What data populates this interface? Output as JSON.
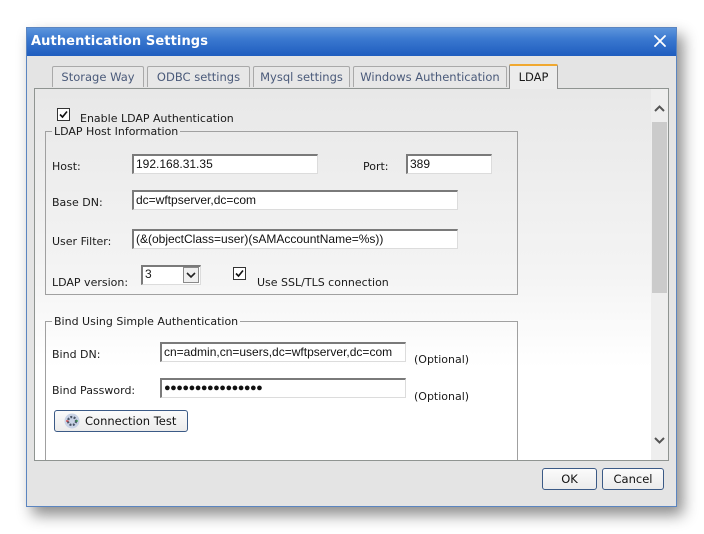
{
  "window": {
    "title": "Authentication Settings",
    "close_icon": "close-icon"
  },
  "tabs": [
    {
      "label": "Storage Way",
      "active": false
    },
    {
      "label": "ODBC settings",
      "active": false
    },
    {
      "label": "Mysql settings",
      "active": false
    },
    {
      "label": "Windows Authentication",
      "active": false
    },
    {
      "label": "LDAP",
      "active": true
    }
  ],
  "ldap": {
    "enable": {
      "label": "Enable LDAP Authentication",
      "checked": true
    },
    "host_group": {
      "legend": "LDAP Host Information",
      "host_label": "Host:",
      "host_value": "192.168.31.35",
      "port_label": "Port:",
      "port_value": "389",
      "base_dn_label": "Base DN:",
      "base_dn_value": "dc=wftpserver,dc=com",
      "user_filter_label": "User Filter:",
      "user_filter_value": "(&(objectClass=user)(sAMAccountName=%s))",
      "version_label": "LDAP version:",
      "version_value": "3",
      "ssl": {
        "label": "Use SSL/TLS connection",
        "checked": true
      }
    },
    "bind_group": {
      "legend": "Bind Using Simple Authentication",
      "bind_dn_label": "Bind DN:",
      "bind_dn_value": "cn=admin,cn=users,dc=wftpserver,dc=com",
      "bind_dn_hint": "(Optional)",
      "bind_password_label": "Bind Password:",
      "bind_password_value": "●●●●●●●●●●●●●●●●",
      "bind_password_hint": "(Optional)",
      "connection_test_label": "Connection Test",
      "connection_test_icon": "gear-icon"
    }
  },
  "footer": {
    "ok_label": "OK",
    "cancel_label": "Cancel"
  },
  "colors": {
    "titlebar": "#1f5dbf",
    "active_tab_accent": "#f0a830",
    "button_border": "#3b5a86"
  }
}
